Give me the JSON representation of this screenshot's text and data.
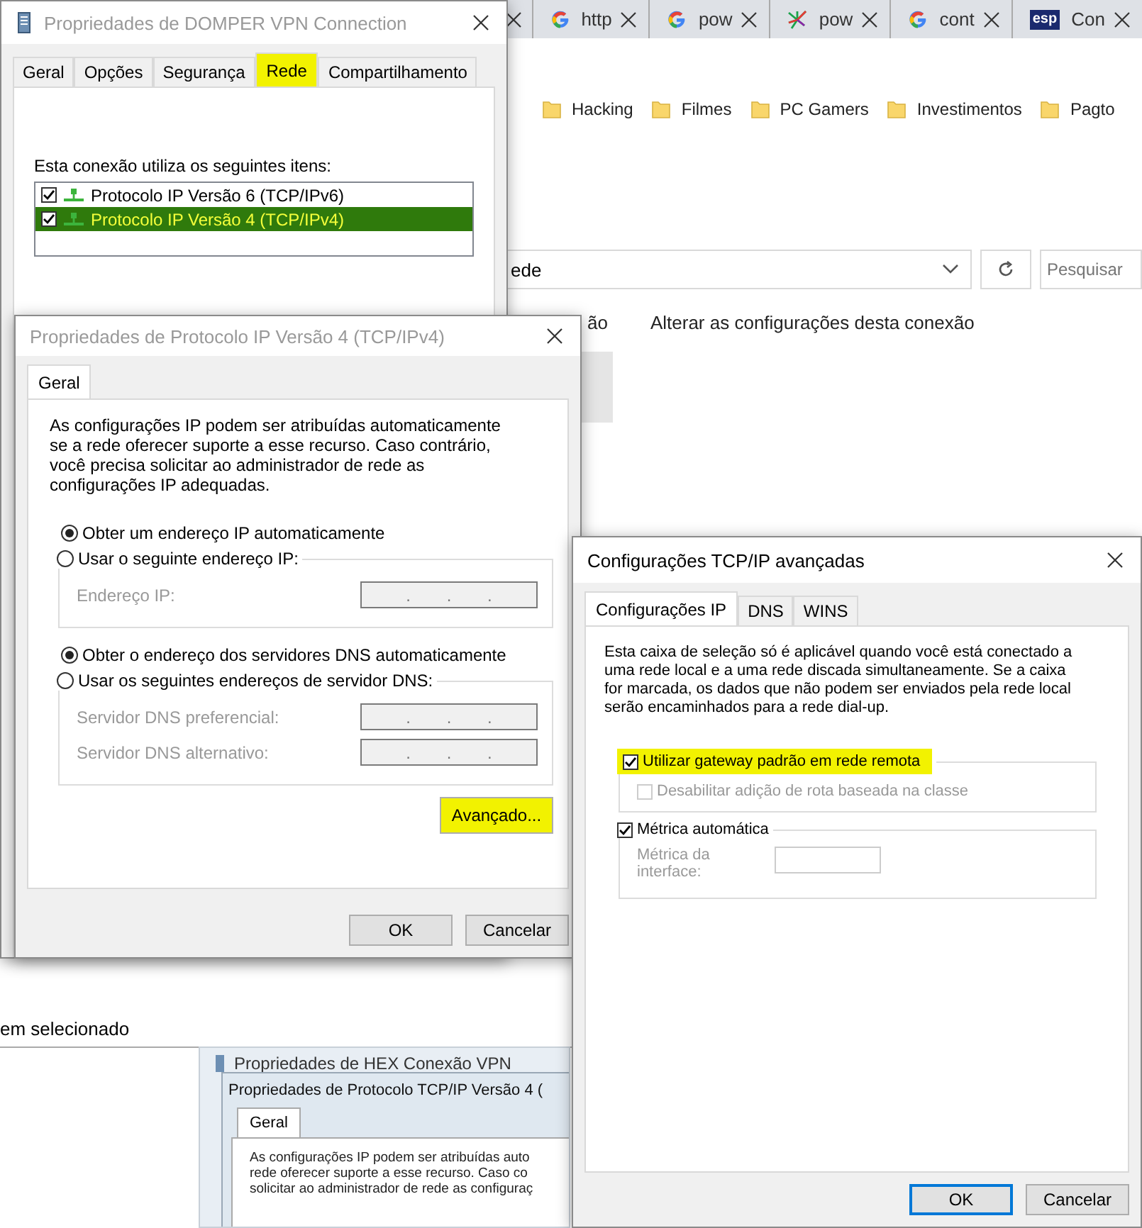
{
  "browser": {
    "tabs": [
      {
        "label": "http",
        "kind": "g"
      },
      {
        "label": "pow",
        "kind": "g"
      },
      {
        "label": "pow",
        "kind": "burst"
      },
      {
        "label": "cont",
        "kind": "g"
      },
      {
        "label": "Con",
        "kind": "badge",
        "icon_text": "esp"
      }
    ],
    "bookmarks": [
      "Hacking",
      "Filmes",
      "PC Gamers",
      "Investimentos",
      "Pagto"
    ]
  },
  "explorer": {
    "address": "ede",
    "search_placeholder": "Pesquisar",
    "commands": [
      "ão",
      "Alterar as configurações desta conexão"
    ],
    "status": "em selecionado"
  },
  "vpn_window": {
    "title": "Propriedades de DOMPER VPN Connection",
    "tabs": [
      {
        "label": "Geral",
        "selected": false,
        "highlighted": false
      },
      {
        "label": "Opções",
        "selected": false,
        "highlighted": false
      },
      {
        "label": "Segurança",
        "selected": false,
        "highlighted": false
      },
      {
        "label": "Rede",
        "selected": true,
        "highlighted": true
      },
      {
        "label": "Compartilhamento",
        "selected": false,
        "highlighted": false
      }
    ],
    "items_label": "Esta conexão utiliza os seguintes itens:",
    "items": [
      {
        "label": "Protocolo IP Versão 6 (TCP/IPv6)",
        "checked": true,
        "selected": false,
        "highlighted": false
      },
      {
        "label": "Protocolo IP Versão 4 (TCP/IPv4)",
        "checked": true,
        "selected": true,
        "highlighted": true
      }
    ]
  },
  "ipv4_window": {
    "title": "Propriedades de Protocolo IP Versão 4 (TCP/IPv4)",
    "tabs": [
      {
        "label": "Geral",
        "selected": true
      }
    ],
    "description": "As configurações IP podem ser atribuídas automaticamente se a rede oferecer suporte a esse recurso. Caso contrário, você precisa solicitar ao administrador de rede as configurações IP adequadas.",
    "ip_options": [
      {
        "label": "Obter um endereço IP automaticamente",
        "selected": true
      },
      {
        "label": "Usar o seguinte endereço IP:",
        "selected": false
      }
    ],
    "ip_fields": [
      {
        "label": "Endereço IP:",
        "value": ". . .",
        "disabled": true
      }
    ],
    "dns_options": [
      {
        "label": "Obter o endereço dos servidores DNS automaticamente",
        "selected": true
      },
      {
        "label": "Usar os seguintes endereços de servidor DNS:",
        "selected": false
      }
    ],
    "dns_fields": [
      {
        "label": "Servidor DNS preferencial:",
        "value": ". . .",
        "disabled": true
      },
      {
        "label": "Servidor DNS alternativo:",
        "value": ". . .",
        "disabled": true
      }
    ],
    "advanced_button": {
      "label": "Avançado...",
      "highlighted": true
    },
    "buttons": [
      "OK",
      "Cancelar"
    ]
  },
  "old_screenshot": {
    "back_title": "Propriedades de HEX Conexão VPN",
    "title": "Propriedades de Protocolo TCP/IP Versão 4 (",
    "tab": "Geral",
    "lines": [
      "As configurações IP podem ser atribuídas auto",
      "rede oferecer suporte a esse recurso. Caso co",
      "solicitar ao administrador de rede as configuraç"
    ]
  },
  "advanced_window": {
    "title": "Configurações TCP/IP avançadas",
    "tabs": [
      {
        "label": "Configurações IP",
        "selected": true
      },
      {
        "label": "DNS",
        "selected": false
      },
      {
        "label": "WINS",
        "selected": false
      }
    ],
    "description": "Esta caixa de seleção só é aplicável quando você está conectado a uma rede local e a uma rede discada simultaneamente. Se a caixa for marcada, os dados que não podem ser enviados pela rede local serão encaminhados para a rede dial-up.",
    "gateway": {
      "label": "Utilizar gateway padrão em rede remota",
      "checked": true,
      "highlighted": true
    },
    "class_route": {
      "label": "Desabilitar adição de rota baseada na classe",
      "checked": false,
      "disabled": true
    },
    "metric": {
      "label": "Métrica automática",
      "checked": true
    },
    "metric_field": {
      "label": "Métrica da interface:",
      "disabled": true
    },
    "buttons": [
      {
        "label": "OK",
        "default": true
      },
      {
        "label": "Cancelar",
        "default": false
      }
    ]
  }
}
